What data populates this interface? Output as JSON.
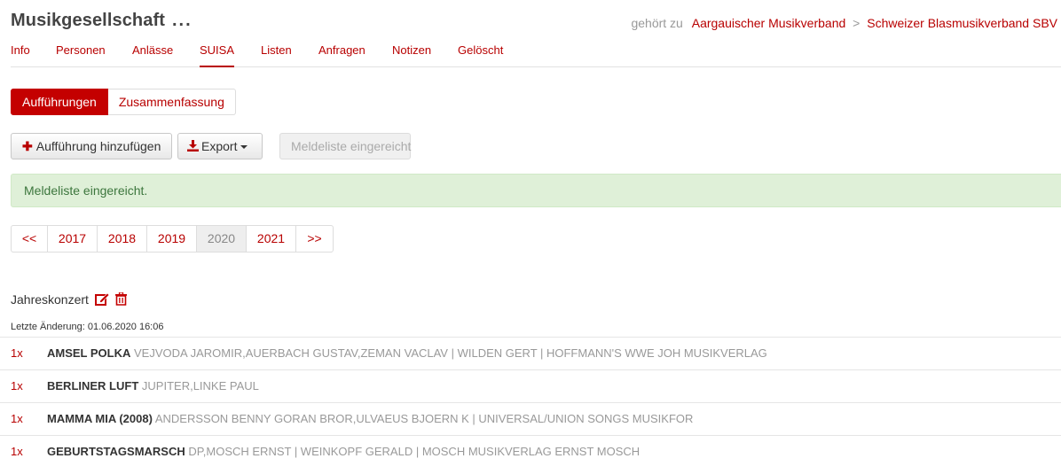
{
  "header": {
    "title": "Musikgesellschaft",
    "title_suffix": "...",
    "belongs_label": "gehört zu",
    "parent_1": "Aargauischer Musikverband",
    "separator": ">",
    "parent_2": "Schweizer Blasmusikverband SBV"
  },
  "nav": {
    "items": [
      "Info",
      "Personen",
      "Anlässe",
      "SUISA",
      "Listen",
      "Anfragen",
      "Notizen",
      "Gelöscht"
    ],
    "active": "SUISA"
  },
  "subtabs": {
    "items": [
      "Aufführungen",
      "Zusammenfassung"
    ],
    "active": "Aufführungen"
  },
  "toolbar": {
    "add_label": "Aufführung hinzufügen",
    "export_label": "Export",
    "submitted_label": "Meldeliste eingereicht"
  },
  "alert": {
    "message": "Meldeliste eingereicht."
  },
  "pager": {
    "prev": "<<",
    "years": [
      "2017",
      "2018",
      "2019",
      "2020",
      "2021"
    ],
    "current": "2020",
    "next": ">>"
  },
  "event": {
    "name": "Jahreskonzert",
    "last_change": "Letzte Änderung: 01.06.2020 16:06"
  },
  "songs": [
    {
      "count": "1x",
      "title": "AMSEL POLKA",
      "info": "VEJVODA JAROMIR,AUERBACH GUSTAV,ZEMAN VACLAV | WILDEN GERT | HOFFMANN'S WWE JOH MUSIKVERLAG"
    },
    {
      "count": "1x",
      "title": "BERLINER LUFT",
      "info": "JUPITER,LINKE PAUL"
    },
    {
      "count": "1x",
      "title": "MAMMA MIA (2008)",
      "info": "ANDERSSON BENNY GORAN BROR,ULVAEUS BJOERN K | UNIVERSAL/UNION SONGS MUSIKFOR"
    },
    {
      "count": "1x",
      "title": "GEBURTSTAGSMARSCH",
      "info": "DP,MOSCH ERNST | WEINKOPF GERALD | MOSCH MUSIKVERLAG ERNST MOSCH"
    }
  ],
  "colors": {
    "accent": "#b80000",
    "success_bg": "#dff0d8",
    "success_text": "#3c763d"
  },
  "icons": {
    "add": "plus-icon",
    "export": "download-icon",
    "edit": "edit-icon",
    "delete": "trash-icon"
  }
}
